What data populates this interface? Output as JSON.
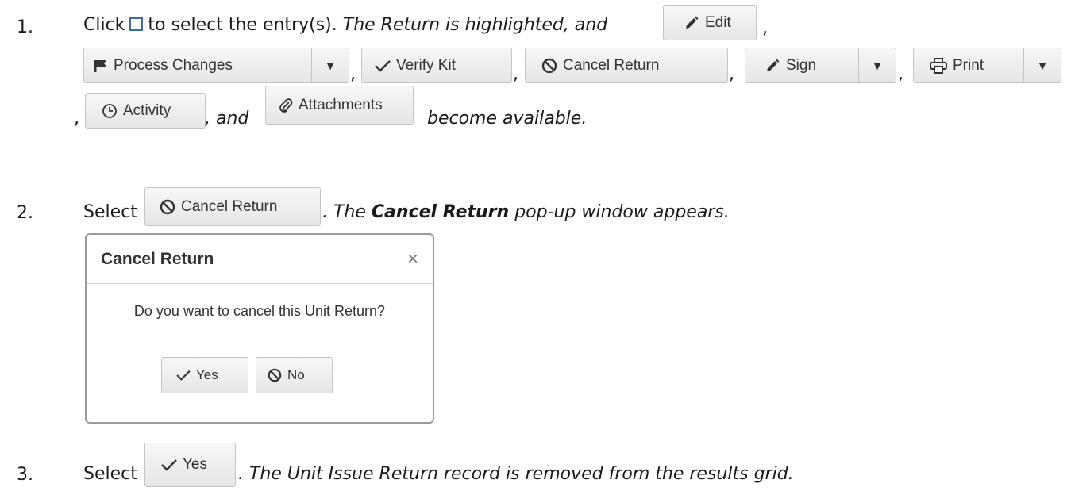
{
  "steps": [
    {
      "number": "1.",
      "text_click": "Click",
      "text_select": "to select the entry(s).",
      "text_italic_a": "The Return is highlighted, and",
      "comma": ",",
      "text_and": ", and",
      "text_available": "become available."
    },
    {
      "number": "2.",
      "text_select": "Select",
      "text_italic_a": ". The",
      "text_bold": "Cancel Return",
      "text_italic_b": "pop-up window appears."
    },
    {
      "number": "3.",
      "text_select": "Select",
      "text_italic": ". The Unit Issue Return record is removed from the results grid."
    }
  ],
  "buttons": {
    "edit": "Edit",
    "process_changes": "Process Changes",
    "verify_kit": "Verify Kit",
    "cancel_return": "Cancel Return",
    "sign": "Sign",
    "print": "Print",
    "activity": "Activity",
    "attachments": "Attachments",
    "yes": "Yes",
    "no": "No"
  },
  "modal": {
    "title": "Cancel Return",
    "close": "×",
    "message": "Do you want to cancel this Unit Return?"
  },
  "caret": "▼",
  "colors": {
    "icon": "#333333",
    "checkbox": "#3a6ea5",
    "button_border": "#c4c4c4"
  }
}
